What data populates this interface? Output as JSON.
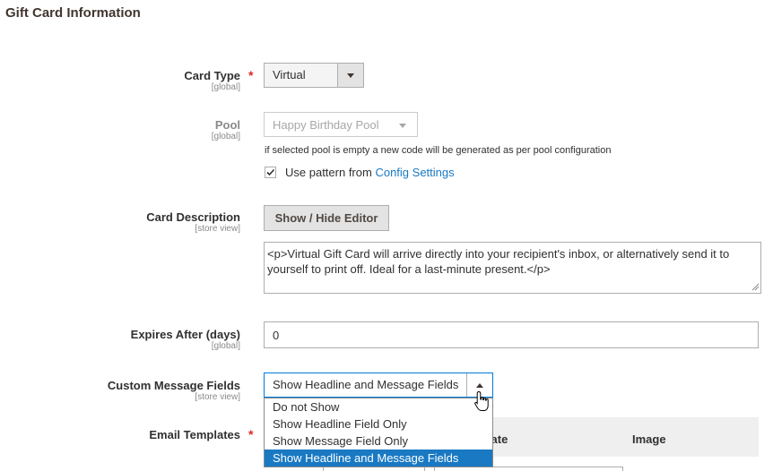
{
  "section": {
    "title": "Gift Card Information"
  },
  "card_type": {
    "label": "Card Type",
    "scope": "[global]",
    "required": "*",
    "value": "Virtual"
  },
  "pool": {
    "label": "Pool",
    "scope": "[global]",
    "value": "Happy Birthday Pool",
    "note": "if selected pool is empty a new code will be generated as per pool configuration",
    "pattern_checkbox_label": "Use pattern from",
    "pattern_link": "Config Settings",
    "pattern_checked": true
  },
  "card_description": {
    "label": "Card Description",
    "scope": "[store view]",
    "editor_button": "Show / Hide Editor",
    "value": "<p>Virtual Gift Card will arrive directly into your recipient's inbox, or alternatively send it to yourself to print off. Ideal for a last-minute present.</p>"
  },
  "expires": {
    "label": "Expires After (days)",
    "scope": "[global]",
    "value": "0"
  },
  "custom_message": {
    "label": "Custom Message Fields",
    "scope": "[store view]",
    "value": "Show Headline and Message Fields",
    "options": [
      "Do not Show",
      "Show Headline Field Only",
      "Show Message Field Only",
      "Show Headline and Message Fields"
    ],
    "selected_index": 3
  },
  "email_templates": {
    "label": "Email Templates",
    "required": "*",
    "columns": {
      "template_partial": "plate",
      "image": "Image"
    }
  }
}
